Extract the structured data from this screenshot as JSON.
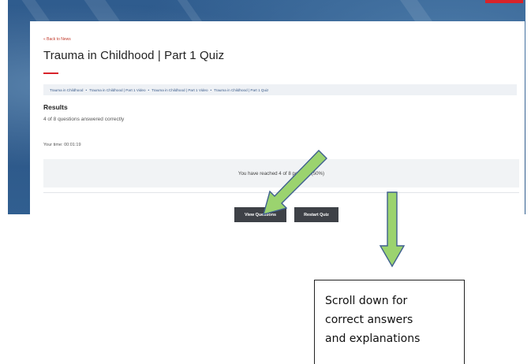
{
  "page": {
    "back_link": "« Back to News",
    "title": "Trauma in Childhood | Part 1 Quiz"
  },
  "breadcrumb": {
    "items": [
      "Trauma in Childhood",
      "Trauma in Childhood | Part 1 Video",
      "Trauma in Childhood | Part 1 Video",
      "Trauma in Childhood | Part 1 Quiz"
    ],
    "separator": "•"
  },
  "results": {
    "heading": "Results",
    "score_text": "4 of 8 questions answered correctly",
    "time_text": "Your time: 00:01:19",
    "points_text": "You have reached 4 of 8 point(s), (50%)"
  },
  "buttons": {
    "view_questions": "View Questions",
    "restart_quiz": "Restart Quiz"
  },
  "callout": {
    "lines": [
      "Scroll down for",
      "correct answers",
      "and explanations"
    ]
  },
  "colors": {
    "accent_red": "#d8232a",
    "header_blue": "#2f5c8e",
    "button_dark": "#3e4147",
    "arrow_green": "#9bd36f",
    "arrow_outline": "#3f5f8f"
  }
}
